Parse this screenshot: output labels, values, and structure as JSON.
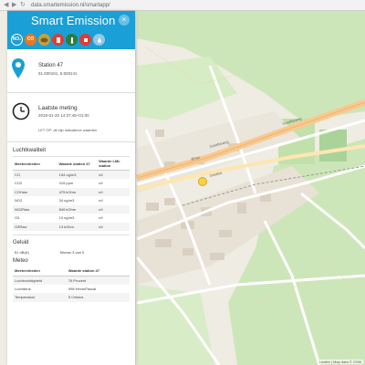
{
  "browser": {
    "back_icon": "back-arrow-icon",
    "forward_icon": "forward-arrow-icon",
    "reload_icon": "reload-icon",
    "url": "data.smartemission.nl/smartapp/"
  },
  "panel": {
    "title": "Smart Emission",
    "close_label": "×",
    "layers": [
      {
        "label": "NO₂",
        "color": "#1a9fd6",
        "icon": "no2-layer-icon"
      },
      {
        "label": "CO",
        "color": "#e87722",
        "icon": "co-layer-icon"
      },
      {
        "label": "",
        "color": "#c8a13c",
        "icon": "o3-layer-icon"
      },
      {
        "label": "",
        "color": "#e03c31",
        "icon": "noise-layer-icon"
      },
      {
        "label": "",
        "color": "#2d7d3a",
        "icon": "temperature-layer-icon"
      },
      {
        "label": "",
        "color": "#e03c31",
        "icon": "humidity-layer-icon"
      },
      {
        "label": "",
        "color": "#8fc9e8",
        "icon": "pressure-layer-icon"
      }
    ],
    "station": {
      "name": "Station 47",
      "coords": "51.830161, 5.828141"
    },
    "measurement": {
      "title": "Laatste meting",
      "time": "2018-01-20 14:37:45+01:00",
      "note": "LET OP: dit zijn indicatieve waarden"
    }
  },
  "luchtkwaliteit": {
    "title": "Luchtkwaliteit",
    "headers": [
      "Meeteenheden",
      "Waarde station 47",
      "Waarde LML station"
    ],
    "rows": [
      [
        "CO",
        "154 ug/m3",
        "n/t"
      ],
      [
        "CO2",
        "415 ppm",
        "n/t"
      ],
      [
        "COHaw",
        "475 kOhm",
        "n/t"
      ],
      [
        "NO2",
        "34 ug/m3",
        "n/t"
      ],
      [
        "NO2Raw",
        "849 kOhm",
        "n/t"
      ],
      [
        "O3",
        "10 ug/m3",
        "n/t"
      ],
      [
        "O3Raw",
        "13 kOhm",
        "n/t"
      ]
    ]
  },
  "geluid": {
    "title": "Geluid",
    "value": "51 dB(A)",
    "level": "Niveau 3 van 5"
  },
  "meteo": {
    "title": "Meteo",
    "headers": [
      "Meeteenheden",
      "Waarde station 47"
    ],
    "rows": [
      [
        "Luchtvochtigheid",
        "76 Procent"
      ],
      [
        "Luchtdruk",
        "998 HectoPascal"
      ],
      [
        "Temperatuur",
        "5 Celsius"
      ]
    ]
  },
  "map": {
    "street_labels": [
      "Graafseweg",
      "Graafseweg",
      "Ernst",
      "Graafse"
    ],
    "attribution": "Leaflet | Map data © OSM"
  }
}
